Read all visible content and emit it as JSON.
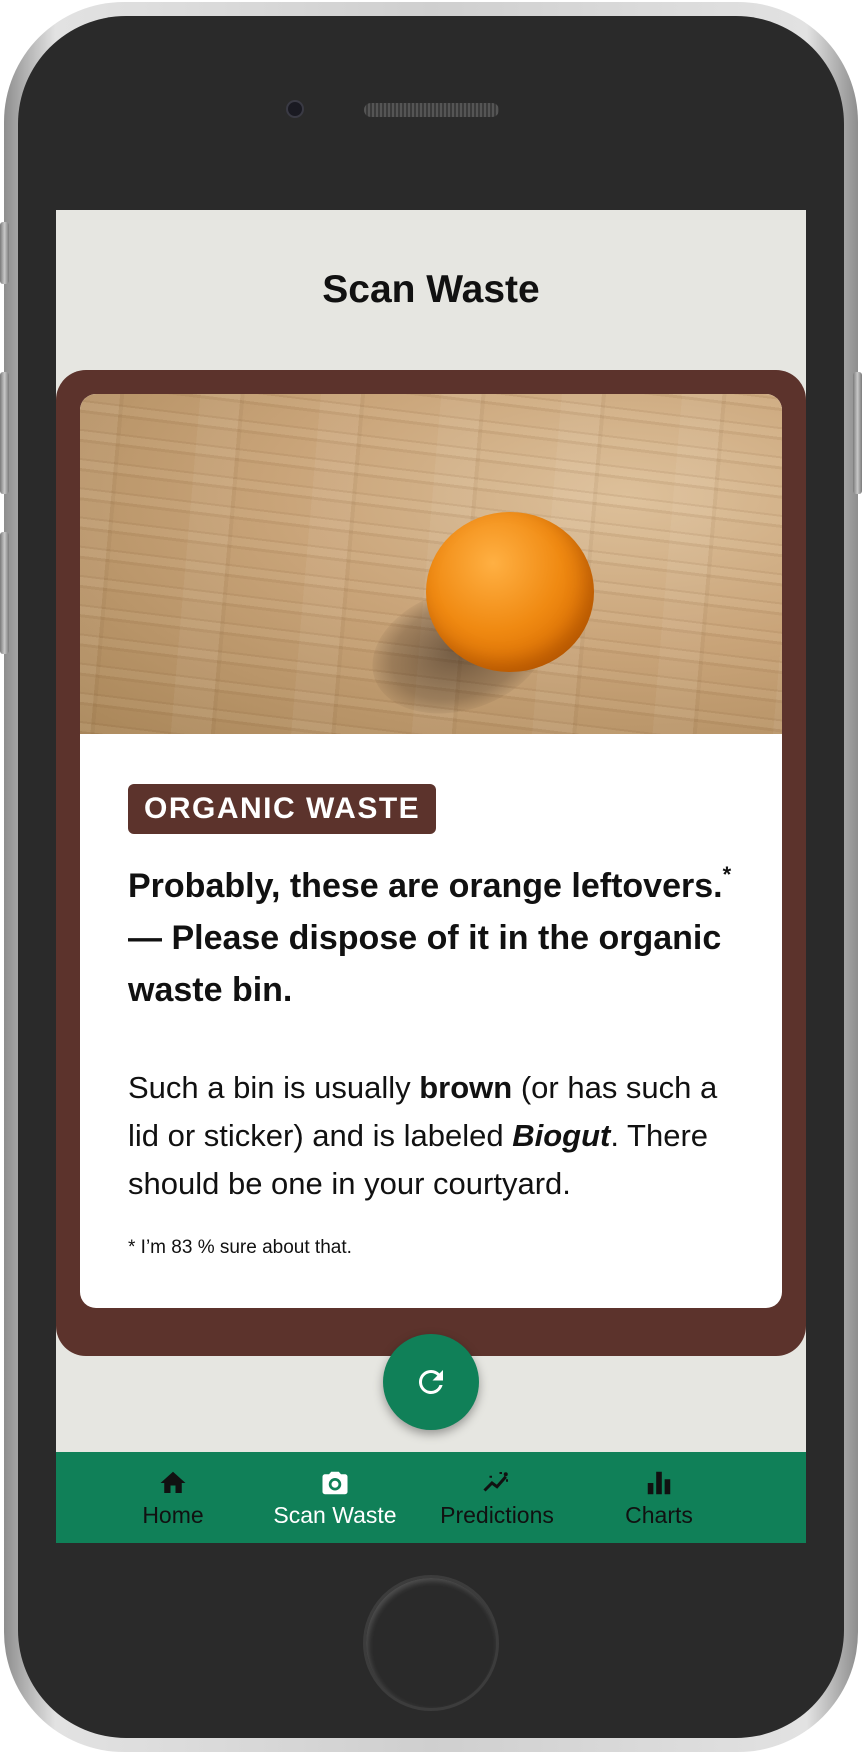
{
  "header": {
    "title": "Scan Waste"
  },
  "result": {
    "category": "ORGANIC WASTE",
    "headline_part1": "Probably, these are orange leftovers.",
    "footnote_marker": "*",
    "headline_part2": " — Please dispose of it in the organic waste bin.",
    "description": {
      "part1": "Such a bin is usually ",
      "bin_color": "brown",
      "part2": " (or has such a lid or sticker) and is labeled ",
      "bin_label": "Biogut",
      "part3": ". There should be one in your courtyard."
    },
    "footnote": "* I’m 83 % sure about that.",
    "confidence_percent": 83
  },
  "refresh_button": {
    "icon": "refresh-icon"
  },
  "bottom_nav": {
    "items": [
      {
        "label": "Home",
        "icon": "home-icon",
        "active": false
      },
      {
        "label": "Scan Waste",
        "icon": "camera-icon",
        "active": true
      },
      {
        "label": "Predictions",
        "icon": "trend-icon",
        "active": false
      },
      {
        "label": "Charts",
        "icon": "bar-chart-icon",
        "active": false
      }
    ]
  },
  "colors": {
    "card_brown": "#5c332c",
    "accent_green": "#108058",
    "screen_background": "#e6e6e1"
  }
}
